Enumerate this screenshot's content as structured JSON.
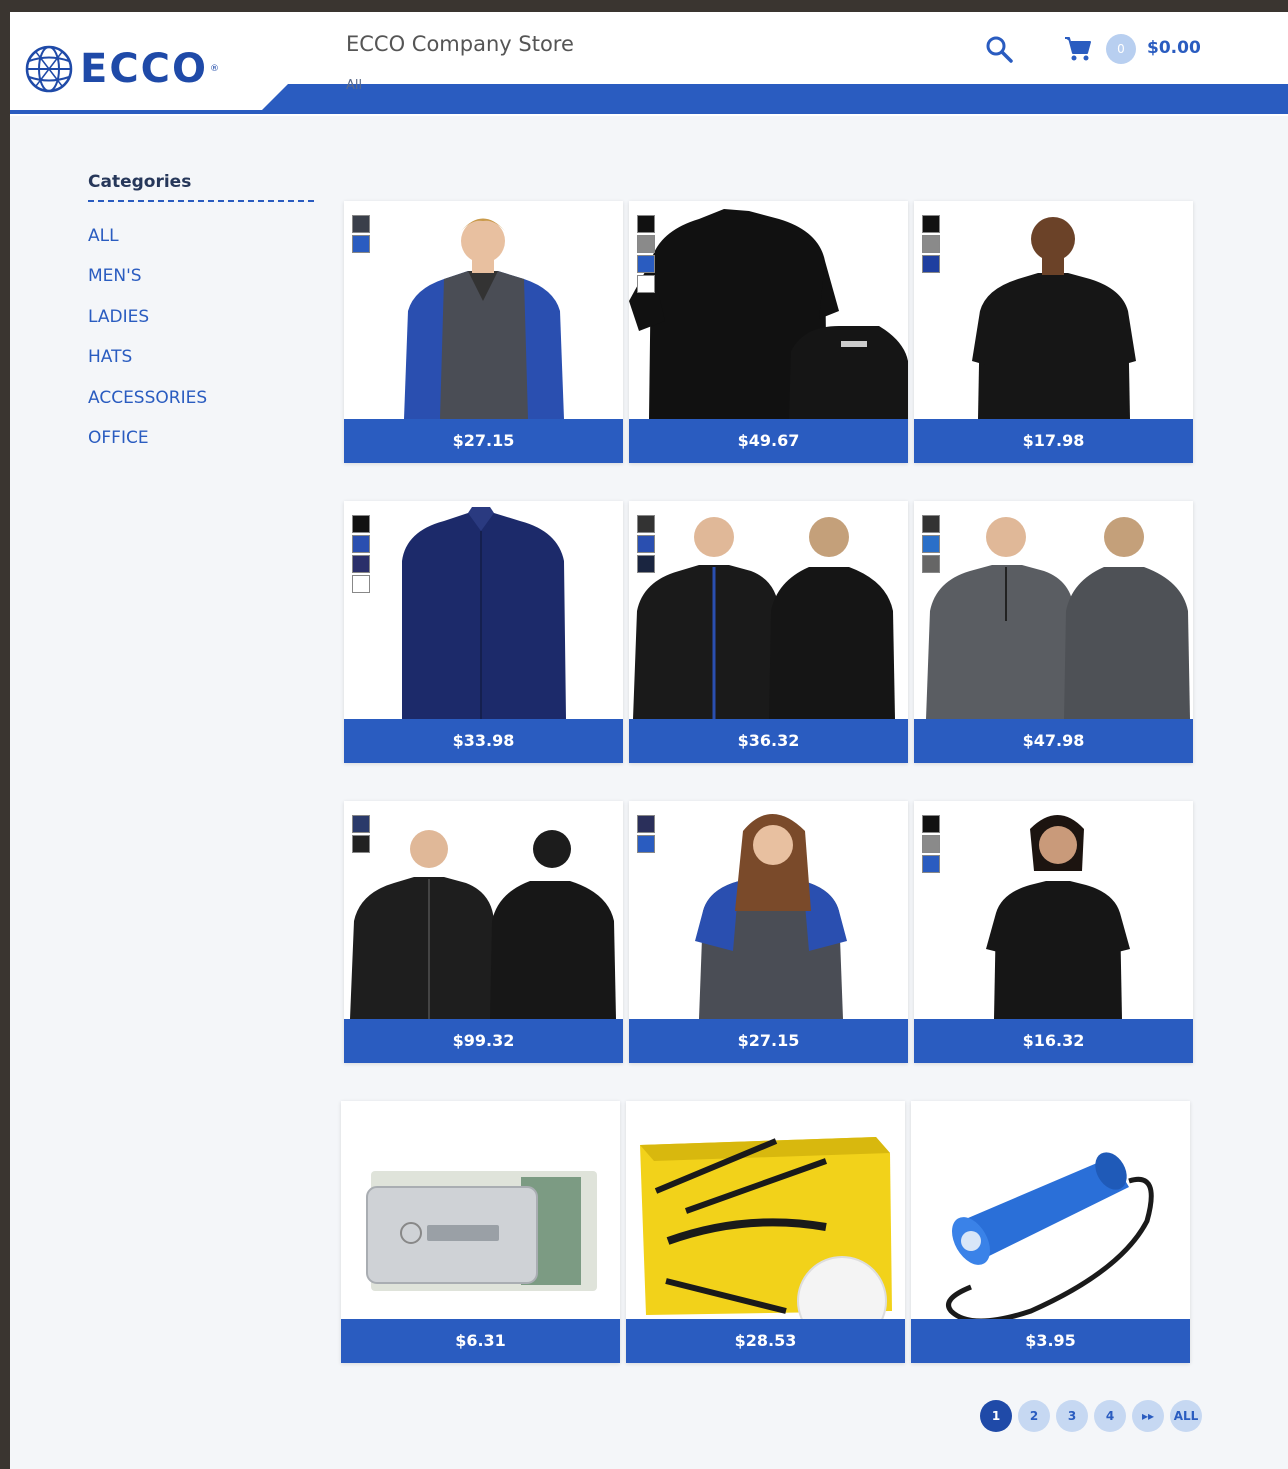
{
  "header": {
    "brand": "ECCO",
    "store_title": "ECCO Company Store",
    "subnav": "All",
    "cart_count": "0",
    "cart_total": "$0.00"
  },
  "sidebar": {
    "title": "Categories",
    "items": [
      {
        "label": "ALL"
      },
      {
        "label": "MEN'S"
      },
      {
        "label": "LADIES"
      },
      {
        "label": "HATS"
      },
      {
        "label": "ACCESSORIES"
      },
      {
        "label": "OFFICE"
      }
    ]
  },
  "products": [
    {
      "price": "$27.15",
      "image": "men-polo-grey-blue",
      "swatches": [
        "#3a3f4a",
        "#2a5cc0"
      ]
    },
    {
      "price": "$49.67",
      "image": "black-polo-front-back",
      "swatches": [
        "#111111",
        "#8a8a8a",
        "#2a5cc0",
        "#ffffff"
      ]
    },
    {
      "price": "$17.98",
      "image": "men-black-tee",
      "swatches": [
        "#111111",
        "#8a8a8a",
        "#1f3fa0"
      ]
    },
    {
      "price": "$33.98",
      "image": "navy-dress-shirt",
      "swatches": [
        "#111111",
        "#2a4fb0",
        "#2a2f6a",
        "#ffffff"
      ]
    },
    {
      "price": "$36.32",
      "image": "black-hoodie",
      "swatches": [
        "#333333",
        "#2a4fb0",
        "#1a2540"
      ]
    },
    {
      "price": "$47.98",
      "image": "grey-quarter-zip",
      "swatches": [
        "#333333",
        "#2a6fc8",
        "#666666"
      ]
    },
    {
      "price": "$99.32",
      "image": "black-jacket",
      "swatches": [
        "#2a3a6a",
        "#222222"
      ]
    },
    {
      "price": "$27.15",
      "image": "ladies-polo-grey-blue",
      "swatches": [
        "#2a2f5a",
        "#2a5cc0"
      ]
    },
    {
      "price": "$16.32",
      "image": "ladies-black-tee",
      "swatches": [
        "#111111",
        "#8a8a8a",
        "#2a5cc0"
      ]
    },
    {
      "price": "$6.31",
      "image": "money-clip",
      "swatches": []
    },
    {
      "price": "$28.53",
      "image": "golf-balls",
      "swatches": []
    },
    {
      "price": "$3.95",
      "image": "flashlight",
      "swatches": []
    }
  ],
  "pagination": {
    "pages": [
      "1",
      "2",
      "3",
      "4"
    ],
    "next_label": "▸▸",
    "all_label": "ALL",
    "current": "1"
  },
  "colors": {
    "accent": "#2a5cc0",
    "brand": "#1f4aa8",
    "text_dark": "#26375a"
  }
}
